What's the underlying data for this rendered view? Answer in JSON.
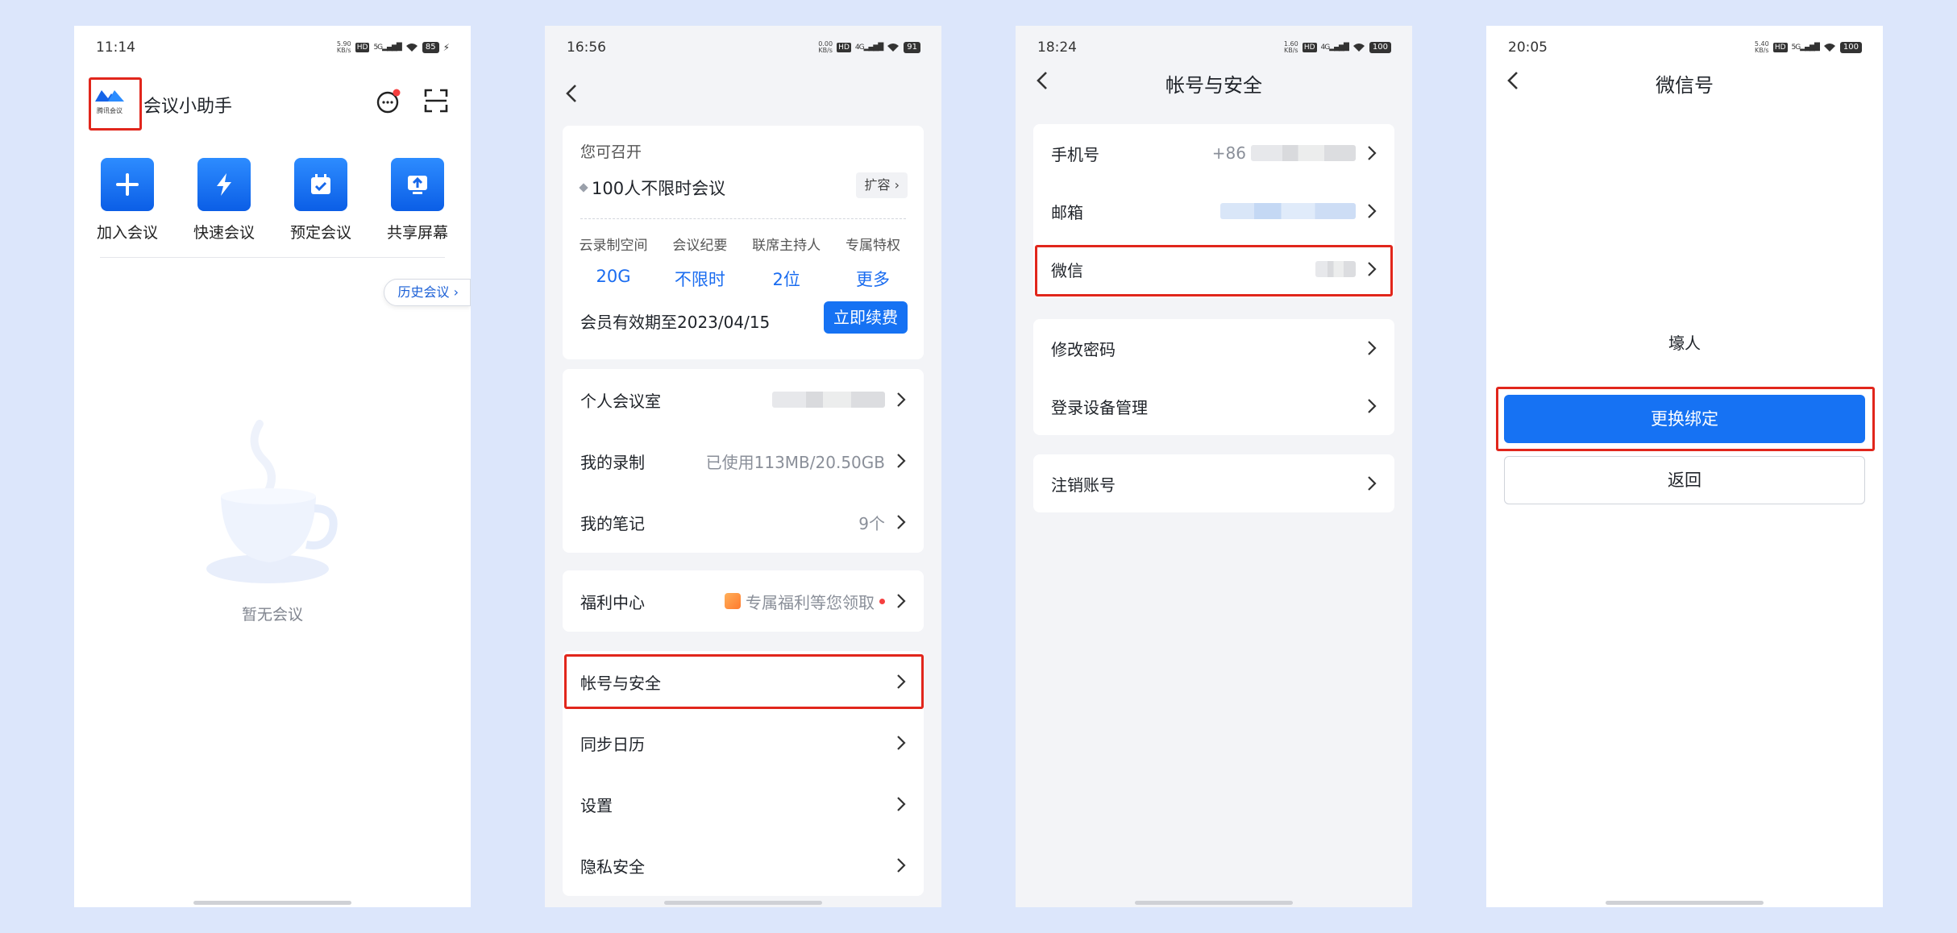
{
  "colors": {
    "background": "#dce6fb",
    "accent": "#1672f3",
    "highlight": "#e1261c"
  },
  "panel1": {
    "status": {
      "time": "11:14",
      "net": "5.90\nKB/s",
      "battery": "85"
    },
    "logo_text": "腾讯会议",
    "title": "会议小助手",
    "quick_actions": [
      {
        "label": "加入会议",
        "icon": "plus-icon"
      },
      {
        "label": "快速会议",
        "icon": "lightning-icon"
      },
      {
        "label": "预定会议",
        "icon": "calendar-check-icon"
      },
      {
        "label": "共享屏幕",
        "icon": "screen-share-icon"
      }
    ],
    "history_label": "历史会议",
    "empty_text": "暂无会议"
  },
  "panel2": {
    "status": {
      "time": "16:56",
      "net": "0.00\nKB/s",
      "battery": "91"
    },
    "member": {
      "can_open": "您可召开",
      "plan": "100人不限时会议",
      "expand_label": "扩容",
      "stats": [
        {
          "label": "云录制空间",
          "value": "20G"
        },
        {
          "label": "会议纪要",
          "value": "不限时"
        },
        {
          "label": "联席主持人",
          "value": "2位"
        },
        {
          "label": "专属特权",
          "value": "更多"
        }
      ],
      "expire": "会员有效期至2023/04/15",
      "renew_label": "立即续费"
    },
    "group1": [
      {
        "label": "个人会议室",
        "value": ""
      },
      {
        "label": "我的录制",
        "value": "已使用113MB/20.50GB"
      },
      {
        "label": "我的笔记",
        "value": "9个"
      }
    ],
    "welfare": {
      "label": "福利中心",
      "value": "专属福利等您领取"
    },
    "group2": [
      {
        "label": "帐号与安全"
      },
      {
        "label": "同步日历"
      },
      {
        "label": "设置"
      },
      {
        "label": "隐私安全"
      }
    ]
  },
  "panel3": {
    "status": {
      "time": "18:24",
      "net": "1.60\nKB/s",
      "battery": "100"
    },
    "title": "帐号与安全",
    "group1": [
      {
        "label": "手机号",
        "value": "+86"
      },
      {
        "label": "邮箱",
        "value": ""
      },
      {
        "label": "微信",
        "value": ""
      }
    ],
    "group2": [
      {
        "label": "修改密码"
      },
      {
        "label": "登录设备管理"
      }
    ],
    "group3": [
      {
        "label": "注销账号"
      }
    ]
  },
  "panel4": {
    "status": {
      "time": "20:05",
      "net": "5.40\nKB/s",
      "battery": "100"
    },
    "title": "微信号",
    "name": "壕人",
    "primary_label": "更换绑定",
    "secondary_label": "返回"
  }
}
